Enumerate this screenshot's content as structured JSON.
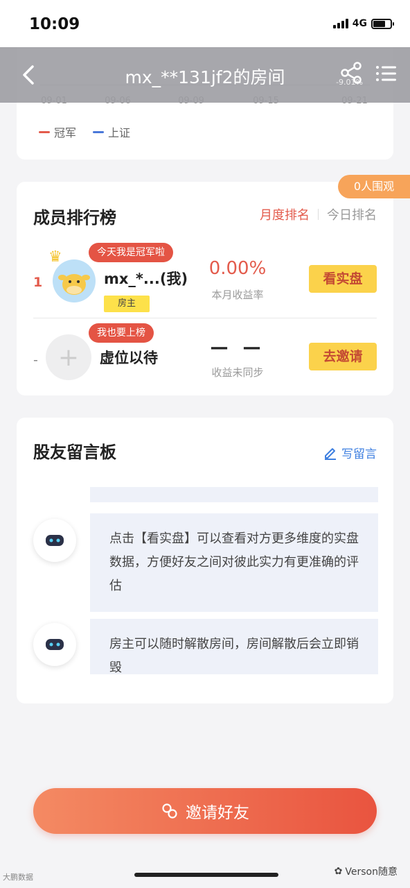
{
  "status_bar": {
    "time": "10:09",
    "network": "4G"
  },
  "nav": {
    "title": "mx_**131jf2的房间",
    "pct_text": "-9.01%"
  },
  "chart_remnant": {
    "x_ticks": [
      "09-01",
      "09-06",
      "09-09",
      "09-15",
      "09-21"
    ],
    "legend": [
      {
        "label": "冠军",
        "color": "#e35b4c"
      },
      {
        "label": "上证",
        "color": "#4a78d9"
      }
    ]
  },
  "ranking": {
    "watch_badge": "0人围观",
    "title": "成员排行榜",
    "tab_month": "月度排名",
    "tab_today": "今日排名",
    "rows": [
      {
        "index": "1",
        "bubble": "今天我是冠军啦",
        "name": "mx_*...(我)",
        "tag": "房主",
        "value": "0.00%",
        "label": "本月收益率",
        "action": "看实盘"
      },
      {
        "index": "-",
        "bubble": "我也要上榜",
        "name": "虚位以待",
        "value": "— —",
        "label": "收益未同步",
        "action": "去邀请"
      }
    ]
  },
  "board": {
    "title": "股友留言板",
    "write_label": "写留言",
    "messages": [
      {
        "text": "点击【看实盘】可以查看对方更多维度的实盘数据，方便好友之间对彼此实力有更准确的评估"
      },
      {
        "text": "房主可以随时解散房间，房间解散后会立即销毁"
      }
    ]
  },
  "invite_label": "邀请好友",
  "watermark_left": "大鹏数据",
  "watermark_right": "Verson随意"
}
